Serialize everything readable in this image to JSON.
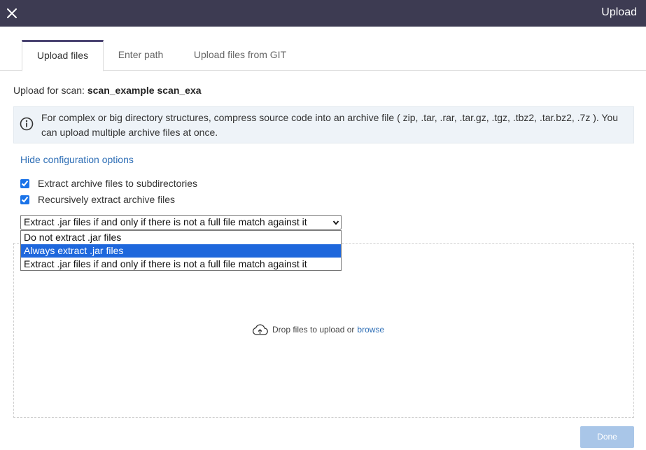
{
  "header": {
    "title": "Upload",
    "close_icon": "close-icon"
  },
  "tabs": [
    {
      "label": "Upload files",
      "active": true
    },
    {
      "label": "Enter path",
      "active": false
    },
    {
      "label": "Upload files from GIT",
      "active": false
    }
  ],
  "scan": {
    "label": "Upload for scan:",
    "name": "scan_example scan_exa"
  },
  "info": {
    "icon": "info-icon",
    "text": "For complex or big directory structures, compress source code into an archive file ( zip, .tar, .rar, .tar.gz, .tgz, .tbz2, .tar.bz2, .7z ). You can upload multiple archive files at once."
  },
  "config": {
    "toggle_label": "Hide configuration options",
    "extract_subdirs": {
      "label": "Extract archive files to subdirectories",
      "checked": true
    },
    "recursive_extract": {
      "label": "Recursively extract archive files",
      "checked": true
    },
    "jar_select": {
      "value": "Extract .jar files if and only if there is not a full file match against it",
      "options": [
        "Do not extract .jar files",
        "Always extract .jar files",
        "Extract .jar files if and only if there is not a full file match against it"
      ],
      "highlighted_index": 1
    }
  },
  "dropzone": {
    "icon": "cloud-upload-icon",
    "text": "Drop files to upload or",
    "browse_label": "browse"
  },
  "footer": {
    "done_label": "Done"
  },
  "colors": {
    "header_bg": "#3d3b52",
    "link": "#2f6fb6",
    "highlight": "#1e67dc",
    "done_bg": "#a9c6e8"
  }
}
